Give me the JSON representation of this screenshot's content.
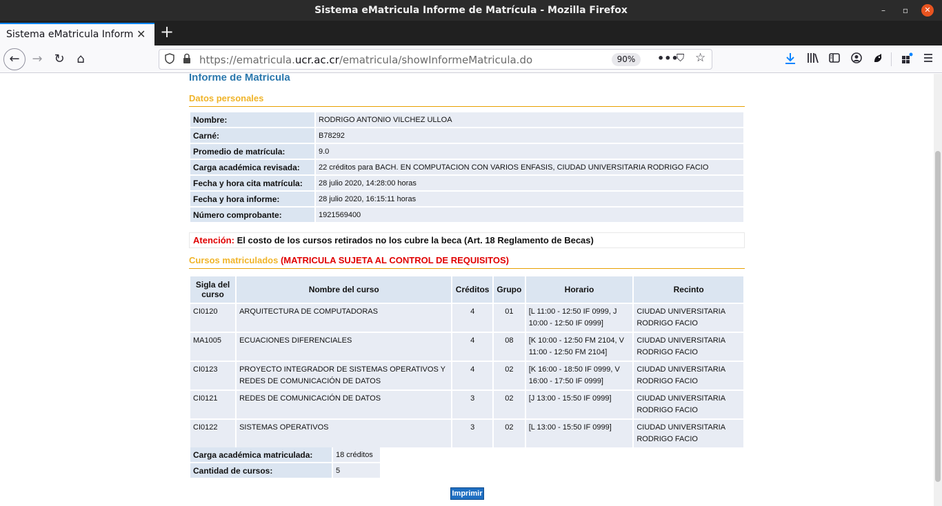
{
  "window": {
    "title": "Sistema eMatricula Informe de Matrícula - Mozilla Firefox",
    "minimize": "–",
    "maximize": "▫",
    "close": "✕"
  },
  "tabs": [
    {
      "label": "Sistema eMatricula Informe de Matrícula",
      "close": "✕"
    }
  ],
  "newtab": "+",
  "nav": {
    "back": "←",
    "forward": "→",
    "reload": "↻",
    "home": "⌂",
    "url_prefix": "https://ematricula.",
    "url_domain": "ucr.ac.cr",
    "url_path": "/ematricula/showInformeMatricula.do",
    "zoom": "90%",
    "more": "•••",
    "pocket": "⛉",
    "star": "☆",
    "icons": [
      "shield-icon",
      "lock-icon",
      "download-icon",
      "library-icon",
      "sidebar-icon",
      "account-icon",
      "extension-icon",
      "puzzle-icon",
      "menu-icon"
    ]
  },
  "page": {
    "title": "Informe de Matrícula",
    "personal_section": "Datos personales",
    "personal": [
      {
        "label": "Nombre:",
        "value": "RODRIGO ANTONIO VILCHEZ ULLOA"
      },
      {
        "label": "Carné:",
        "value": "B78292"
      },
      {
        "label": "Promedio de matrícula:",
        "value": "9.0"
      },
      {
        "label": "Carga académica revisada:",
        "value": "22 créditos para BACH. EN COMPUTACION CON VARIOS ENFASIS, CIUDAD UNIVERSITARIA RODRIGO FACIO"
      },
      {
        "label": "Fecha y hora cita matrícula:",
        "value": "28 julio 2020, 14:28:00 horas"
      },
      {
        "label": "Fecha y hora informe:",
        "value": "28 julio 2020, 16:15:11 horas"
      },
      {
        "label": "Número comprobante:",
        "value": "1921569400"
      }
    ],
    "notice": {
      "prefix": "Atención:",
      "text": " El costo de los cursos retirados no los cubre la beca (Art. 18 Reglamento de Becas)"
    },
    "courses_section": "Cursos matriculados",
    "courses_requirement": " (MATRICULA SUJETA AL CONTROL DE REQUISITOS)",
    "course_headers": [
      "Sigla del curso",
      "Nombre del curso",
      "Créditos",
      "Grupo",
      "Horario",
      "Recinto"
    ],
    "courses": [
      {
        "sigla": "CI0120",
        "nombre": "ARQUITECTURA DE COMPUTADORAS",
        "creditos": "4",
        "grupo": "01",
        "horario": "[L 11:00 - 12:50 IF 0999, J 10:00 - 12:50 IF 0999]",
        "recinto": "CIUDAD UNIVERSITARIA RODRIGO FACIO"
      },
      {
        "sigla": "MA1005",
        "nombre": "ECUACIONES DIFERENCIALES",
        "creditos": "4",
        "grupo": "08",
        "horario": "[K 10:00 - 12:50 FM 2104, V 11:00 - 12:50 FM 2104]",
        "recinto": "CIUDAD UNIVERSITARIA RODRIGO FACIO"
      },
      {
        "sigla": "CI0123",
        "nombre": "PROYECTO INTEGRADOR DE SISTEMAS OPERATIVOS Y REDES DE COMUNICACIÓN DE DATOS",
        "creditos": "4",
        "grupo": "02",
        "horario": "[K 16:00 - 18:50 IF 0999, V 16:00 - 17:50 IF 0999]",
        "recinto": "CIUDAD UNIVERSITARIA RODRIGO FACIO"
      },
      {
        "sigla": "CI0121",
        "nombre": "REDES DE COMUNICACIÓN DE DATOS",
        "creditos": "3",
        "grupo": "02",
        "horario": "[J 13:00 - 15:50 IF 0999]",
        "recinto": "CIUDAD UNIVERSITARIA RODRIGO FACIO"
      },
      {
        "sigla": "CI0122",
        "nombre": "SISTEMAS OPERATIVOS",
        "creditos": "3",
        "grupo": "02",
        "horario": "[L 13:00 - 15:50 IF 0999]",
        "recinto": "CIUDAD UNIVERSITARIA RODRIGO FACIO"
      }
    ],
    "summary": [
      {
        "label": "Carga académica matriculada:",
        "value": "18 créditos"
      },
      {
        "label": "Cantidad de cursos:",
        "value": "5"
      }
    ],
    "print_label": "Imprimir"
  }
}
